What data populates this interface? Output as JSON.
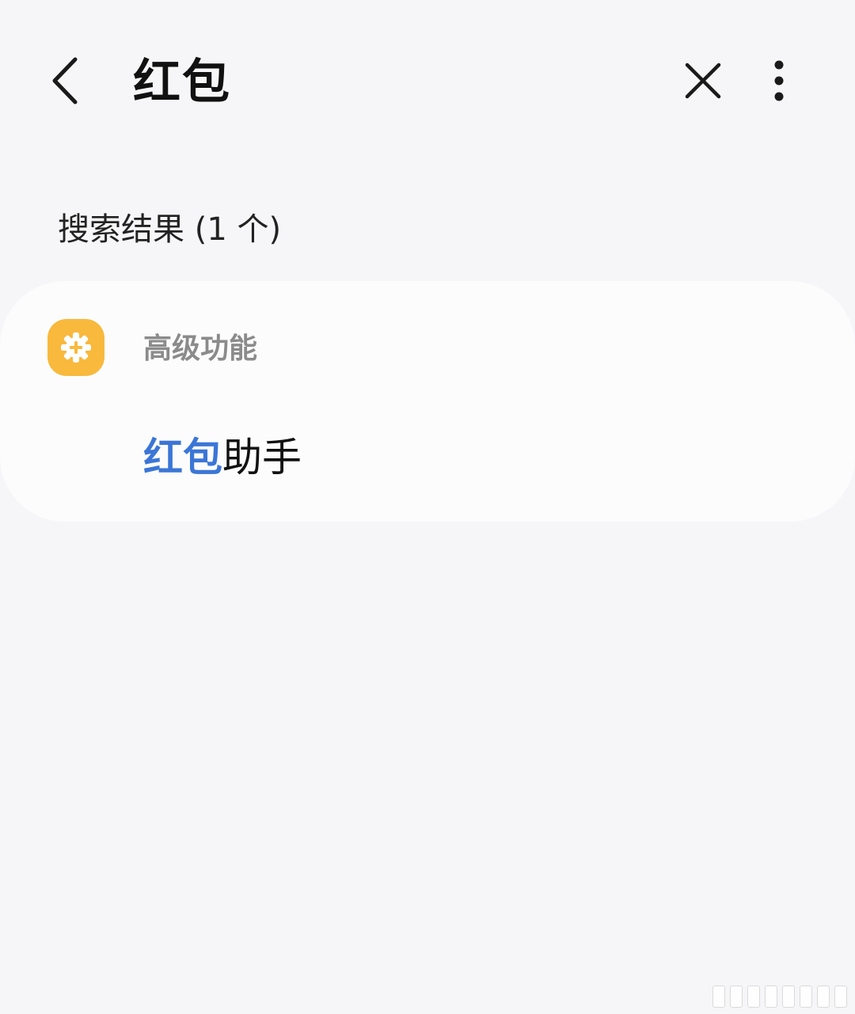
{
  "header": {
    "back_icon": "chevron-left-icon",
    "query": "红包",
    "clear_icon": "close-icon",
    "more_icon": "more-vertical-icon"
  },
  "results": {
    "header": "搜索结果 (1 个)",
    "groups": [
      {
        "category": "高级功能",
        "icon": "gear-plus-icon",
        "icon_color": "#f8b93c",
        "items": [
          {
            "highlight": "红包",
            "rest": "助手",
            "highlight_color": "#3b76d6"
          }
        ]
      }
    ]
  }
}
